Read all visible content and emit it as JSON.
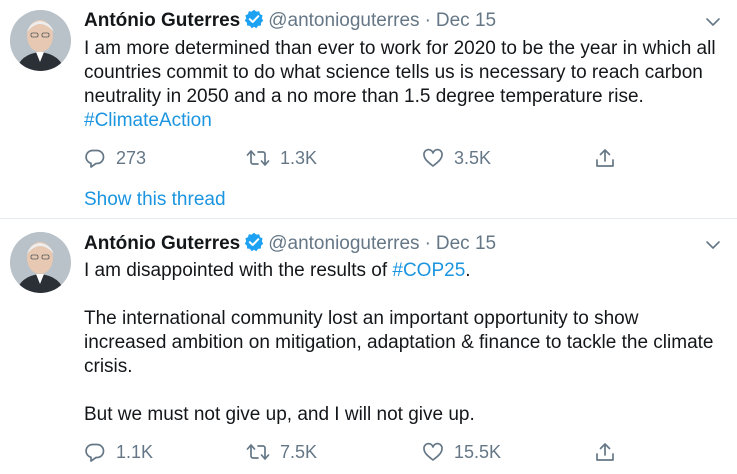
{
  "tweets": [
    {
      "author_name": "António Guterres",
      "handle": "@antonioguterres",
      "separator": "·",
      "date": "Dec 15",
      "body": [
        [
          {
            "text": "I am more determined than ever to work for 2020 to be the year in which all countries commit to do what science tells us is necessary to reach carbon neutrality in 2050 and a no more than 1.5 degree temperature rise. ",
            "type": "text"
          },
          {
            "text": "#ClimateAction",
            "type": "hashtag"
          }
        ]
      ],
      "replies": "273",
      "retweets": "1.3K",
      "likes": "3.5K",
      "show_thread": "Show this thread"
    },
    {
      "author_name": "António Guterres",
      "handle": "@antonioguterres",
      "separator": "·",
      "date": "Dec 15",
      "body": [
        [
          {
            "text": "I am disappointed with the results of ",
            "type": "text"
          },
          {
            "text": "#COP25",
            "type": "hashtag"
          },
          {
            "text": ".",
            "type": "text"
          }
        ],
        [
          {
            "text": "The international community lost an important opportunity to show increased ambition on mitigation, adaptation & finance to tackle the climate crisis.",
            "type": "text"
          }
        ],
        [
          {
            "text": "But we must not give up, and I will not give up.",
            "type": "text"
          }
        ]
      ],
      "replies": "1.1K",
      "retweets": "7.5K",
      "likes": "15.5K"
    }
  ],
  "icons": {
    "verified": "verified-badge-icon",
    "caret": "chevron-down-icon",
    "reply": "reply-icon",
    "retweet": "retweet-icon",
    "like": "heart-icon",
    "share": "share-icon"
  },
  "colors": {
    "link": "#1b95e0",
    "muted": "#657786",
    "text": "#14171a",
    "divider": "#e6ecf0"
  }
}
